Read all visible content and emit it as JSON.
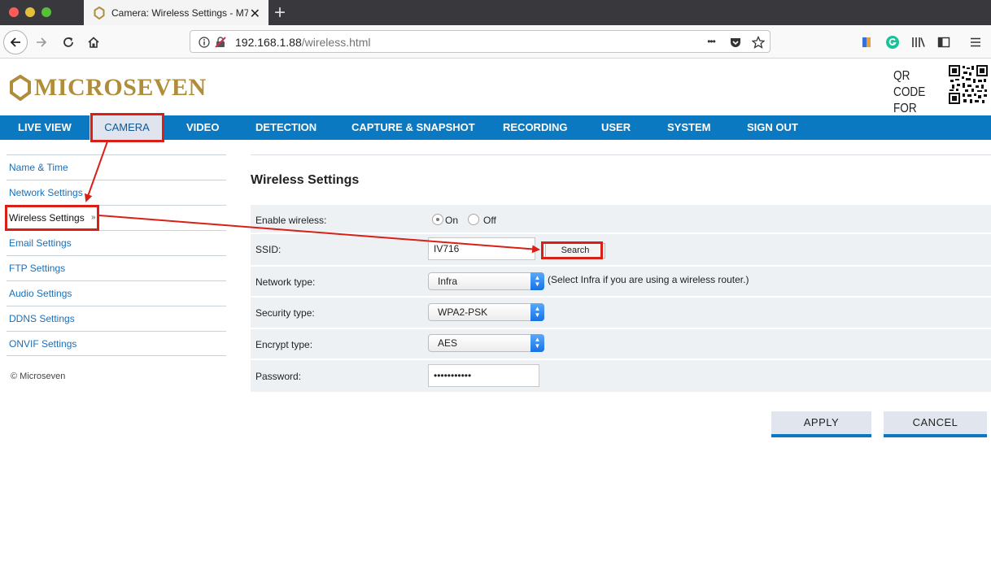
{
  "browser": {
    "tab_title": "Camera: Wireless Settings - M7",
    "tab_close": "✕",
    "new_tab": "+",
    "url_host": "192.168.1.88",
    "url_path": "/wireless.html",
    "more_dots": "•••"
  },
  "header": {
    "logo_text": "MICROSEVEN",
    "qr_label_line1": "QR CODE",
    "qr_label_line2": "FOR APP"
  },
  "menu": {
    "items": [
      {
        "label": "LIVE VIEW"
      },
      {
        "label": "CAMERA"
      },
      {
        "label": "VIDEO"
      },
      {
        "label": "DETECTION"
      },
      {
        "label": "CAPTURE & SNAPSHOT"
      },
      {
        "label": "RECORDING"
      },
      {
        "label": "USER"
      },
      {
        "label": "SYSTEM"
      },
      {
        "label": "SIGN OUT"
      }
    ],
    "active": "CAMERA"
  },
  "sidebar": {
    "items": [
      {
        "label": "Name & Time"
      },
      {
        "label": "Network Settings"
      },
      {
        "label": "Wireless Settings"
      },
      {
        "label": "Email Settings"
      },
      {
        "label": "FTP Settings"
      },
      {
        "label": "Audio Settings"
      },
      {
        "label": "DDNS Settings"
      },
      {
        "label": "ONVIF Settings"
      }
    ],
    "active_arrow": "»",
    "copyright": "© Microseven"
  },
  "content": {
    "heading": "Wireless Settings",
    "enable_label": "Enable wireless:",
    "on_label": "On",
    "off_label": "Off",
    "wireless_enabled": true,
    "ssid_label": "SSID:",
    "ssid_value": "IV716",
    "search_label": "Search",
    "network_type_label": "Network type:",
    "network_type_value": "Infra",
    "network_type_hint": "(Select Infra if you are using a wireless router.)",
    "security_type_label": "Security type:",
    "security_type_value": "WPA2-PSK",
    "encrypt_type_label": "Encrypt type:",
    "encrypt_type_value": "AES",
    "password_label": "Password:",
    "password_value": "•••••••••••",
    "apply_label": "APPLY",
    "cancel_label": "CANCEL"
  },
  "colors": {
    "menu_blue": "#0a79c1",
    "logo_gold": "#b08d3a",
    "annotation_red": "#d82016",
    "link_blue": "#1b6fb6"
  }
}
